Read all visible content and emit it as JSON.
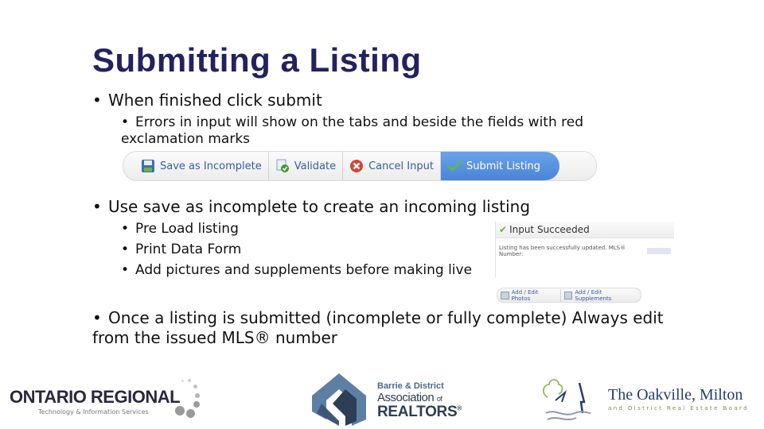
{
  "slide": {
    "title": "Submitting a Listing",
    "bullets": [
      {
        "text": "When finished click submit",
        "sub": [
          "Errors in input will show on the tabs and beside the fields with red exclamation marks"
        ]
      },
      {
        "text": "Use save as incomplete to create an incoming listing",
        "sub": [
          "Pre Load listing",
          "Print Data Form",
          "Add pictures and supplements before making live"
        ]
      },
      {
        "text": "Once a listing is submitted (incomplete or fully complete) Always edit from the issued MLS® number",
        "sub": []
      }
    ],
    "bullet_glyph": "•"
  },
  "toolbar": {
    "buttons": [
      {
        "label": "Save as Incomplete",
        "icon": "floppy-disk-icon"
      },
      {
        "label": "Validate",
        "icon": "validate-check-icon"
      },
      {
        "label": "Cancel Input",
        "icon": "cancel-x-icon"
      },
      {
        "label": "Submit Listing",
        "icon": "checkmark-icon"
      }
    ],
    "accent_color": "#4b84d8"
  },
  "success_panel": {
    "header": "Input Succeeded",
    "message": "Listing has been successfully updated. MLS® Number:",
    "actions": [
      "Add / Edit Photos",
      "Add / Edit Supplements"
    ]
  },
  "logos": {
    "ontario": {
      "name": "ONTARIO REGIONAL",
      "subtitle": "Technology & Information Services"
    },
    "barrie": {
      "line1": "Barrie & District",
      "line2": "Association",
      "line2_suffix": "of",
      "line3": "REALTORS",
      "mark": "®"
    },
    "oakville": {
      "line1": "The Oakville, Milton",
      "line2": "and District Real Estate Board"
    }
  }
}
